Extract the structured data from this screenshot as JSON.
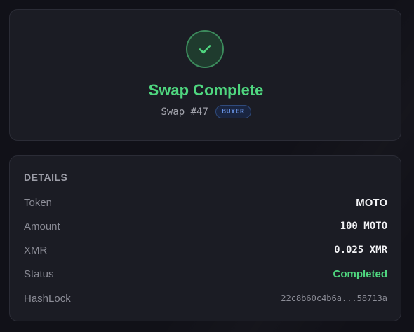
{
  "header": {
    "title": "Swap Complete",
    "swap_label": "Swap #47",
    "role_badge": "BUYER"
  },
  "details": {
    "section_title": "DETAILS",
    "rows": [
      {
        "label": "Token",
        "value": "MOTO"
      },
      {
        "label": "Amount",
        "value": "100 MOTO"
      },
      {
        "label": "XMR",
        "value": "0.025 XMR"
      },
      {
        "label": "Status",
        "value": "Completed"
      },
      {
        "label": "HashLock",
        "value": "22c8b60c4b6a...58713a"
      }
    ]
  },
  "colors": {
    "success": "#4fd67f",
    "badge_blue": "#6f9cf2",
    "card_bg": "#1b1c24",
    "page_bg": "#111118"
  },
  "icons": {
    "status": "checkmark-icon"
  }
}
